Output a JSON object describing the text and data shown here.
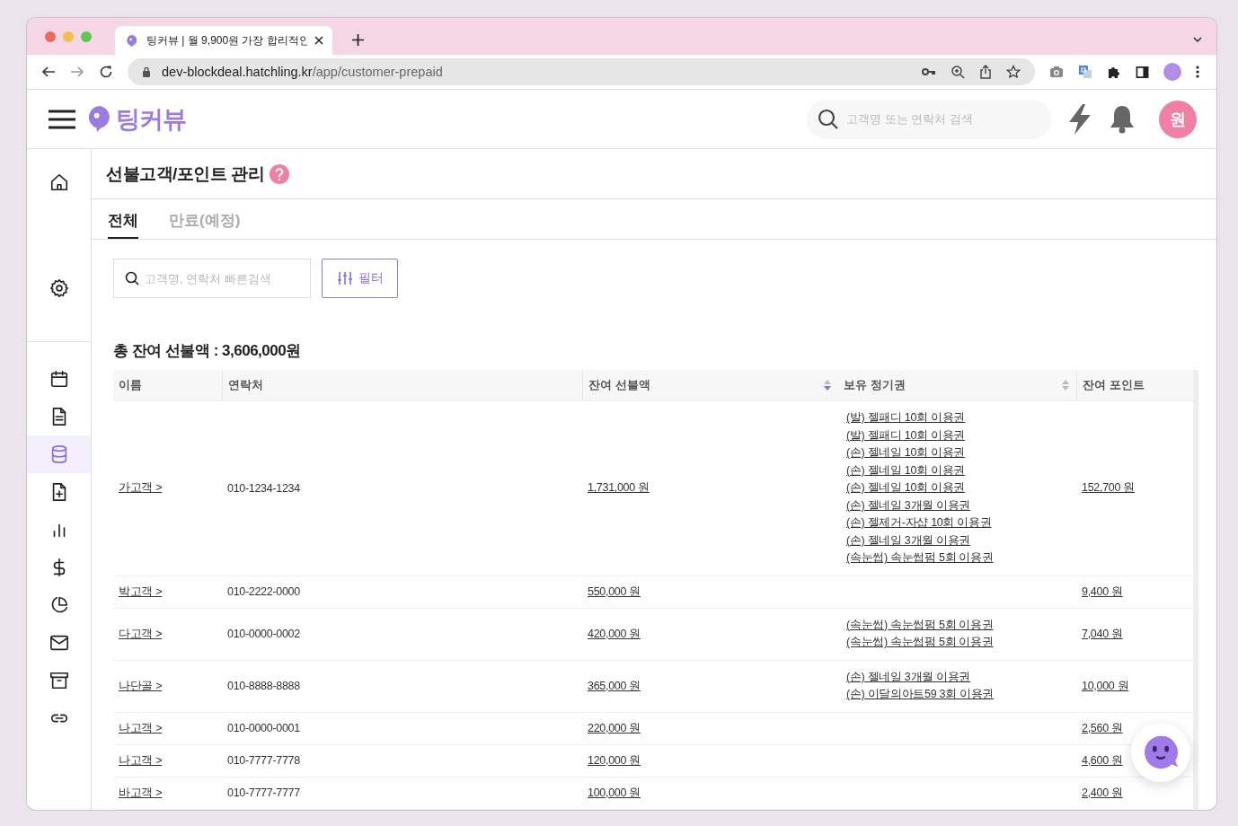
{
  "browser": {
    "tab_title": "팅커뷰 | 월 9,900원 가장 합리적인",
    "url_host": "dev-blockdeal.hatchling.kr",
    "url_path": "/app/customer-prepaid"
  },
  "header": {
    "logo": "팅커뷰",
    "search": {
      "placeholder": "고객명 또는 연락처 검색"
    },
    "avatar": "원"
  },
  "sidebar": {
    "items": [
      {
        "selected": false
      },
      {
        "selected": false
      },
      {
        "selected": false
      },
      {
        "selected": false
      },
      {
        "selected": true
      },
      {
        "selected": false
      },
      {
        "selected": false
      },
      {
        "selected": false
      },
      {
        "selected": false
      },
      {
        "selected": false
      },
      {
        "selected": false
      },
      {
        "selected": false
      }
    ]
  },
  "page": {
    "title": "선불고객/포인트 관리",
    "tabs": [
      {
        "label": "전체",
        "selected": true
      },
      {
        "label": "만료(예정)",
        "selected": false
      }
    ],
    "quick_search": {
      "placeholder": "고객명, 연락처 빠른검색"
    },
    "filter_button": "필터",
    "total": "총 잔여 선불액 : 3,606,000원"
  },
  "table": {
    "columns": [
      {
        "label": "이름"
      },
      {
        "label": "연락처"
      },
      {
        "label": "잔여 선불액",
        "sortable": true,
        "sorted": true
      },
      {
        "label": "보유 정기권",
        "sortable": true,
        "sorted": false
      },
      {
        "label": "잔여 포인트"
      }
    ],
    "rows": [
      {
        "name": "가고객 >",
        "phone": "010-1234-1234",
        "prepaid": "1,731,000 원",
        "passes": [
          "(발) 젤패디 10회 이용권",
          "(발) 젤패디 10회 이용권",
          "(손) 젤네일 10회 이용권",
          "(손) 젤네일 10회 이용권",
          "(손) 젤네일 10회 이용권",
          "(손) 젤네일 3개월 이용권",
          "(손) 젤제거-자샵 10회 이용권",
          "(손) 젤네일 3개월 이용권",
          "(속눈썹) 속눈썹펌 5회 이용권"
        ],
        "points": "152,700 원"
      },
      {
        "name": "박고객 >",
        "phone": "010-2222-0000",
        "prepaid": "550,000 원",
        "passes": [],
        "points": "9,400 원"
      },
      {
        "name": "다고객 >",
        "phone": "010-0000-0002",
        "prepaid": "420,000 원",
        "passes": [
          "(속눈썹) 속눈썹펌 5회 이용권",
          "(속눈썹) 속눈썹펌 5회 이용권"
        ],
        "points": "7,040 원"
      },
      {
        "name": "나단골 >",
        "phone": "010-8888-8888",
        "prepaid": "365,000 원",
        "passes": [
          "(손) 젤네일 3개월 이용권",
          "(손) 이달의아트59 3회 이용권"
        ],
        "points": "10,000 원"
      },
      {
        "name": "나고객 >",
        "phone": "010-0000-0001",
        "prepaid": "220,000 원",
        "passes": [],
        "points": "2,560 원"
      },
      {
        "name": "나고객 >",
        "phone": "010-7777-7778",
        "prepaid": "120,000 원",
        "passes": [],
        "points": "4,600 원"
      },
      {
        "name": "바고객 >",
        "phone": "010-7777-7777",
        "prepaid": "100,000 원",
        "passes": [],
        "points": "2,400 원"
      }
    ]
  }
}
